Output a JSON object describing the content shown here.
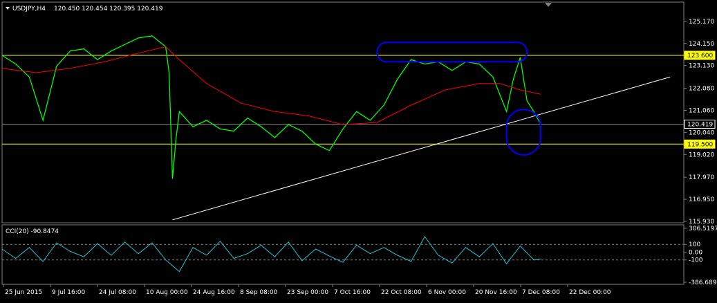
{
  "header": {
    "symbol": "USDJPY,H4",
    "ohlc": "120.450 120.454 120.395 120.419"
  },
  "colors": {
    "price": "#00ff00",
    "ma": "#ff0000",
    "cci": "#1fc6d8",
    "level": "#ffff00",
    "annotation": "#0000ff",
    "trendline": "#ffffff",
    "grid": "#808080"
  },
  "chart_data": [
    {
      "type": "line",
      "title": "USDJPY,H4",
      "ylim": [
        115.93,
        125.9
      ],
      "ytick_labels": [
        "125.170",
        "124.150",
        "123.130",
        "122.080",
        "121.060",
        "120.040",
        "119.020",
        "117.970",
        "116.950",
        "115.930"
      ],
      "price_tags": [
        {
          "label": "123.600",
          "value": 123.6,
          "style": "yellow"
        },
        {
          "label": "120.419",
          "value": 120.419,
          "style": "white"
        },
        {
          "label": "119.500",
          "value": 119.5,
          "style": "yellow"
        }
      ],
      "horizontal_levels": [
        123.6,
        119.5
      ],
      "current_price_line": 120.419,
      "series": [
        {
          "role": "price",
          "x": [
            0,
            0.02,
            0.04,
            0.06,
            0.08,
            0.1,
            0.12,
            0.14,
            0.16,
            0.18,
            0.2,
            0.22,
            0.24,
            0.245,
            0.25,
            0.255,
            0.26,
            0.28,
            0.3,
            0.32,
            0.34,
            0.36,
            0.38,
            0.4,
            0.42,
            0.44,
            0.46,
            0.48,
            0.5,
            0.52,
            0.54,
            0.56,
            0.58,
            0.6,
            0.62,
            0.64,
            0.66,
            0.68,
            0.7,
            0.72,
            0.74,
            0.75,
            0.76,
            0.77,
            0.78,
            0.79
          ],
          "values": [
            123.6,
            123.2,
            122.6,
            120.6,
            123.1,
            123.8,
            123.9,
            123.4,
            123.8,
            124.1,
            124.4,
            124.5,
            124.0,
            122.8,
            117.9,
            119.7,
            121.0,
            120.3,
            120.6,
            120.2,
            120.1,
            120.7,
            120.3,
            119.8,
            120.4,
            120.1,
            119.5,
            119.2,
            120.2,
            121.0,
            120.6,
            121.3,
            122.5,
            123.4,
            123.2,
            123.3,
            122.9,
            123.3,
            123.2,
            122.6,
            121.0,
            122.5,
            123.5,
            121.5,
            121.0,
            120.42
          ]
        },
        {
          "role": "moving-average",
          "x": [
            0,
            0.05,
            0.1,
            0.15,
            0.2,
            0.24,
            0.26,
            0.3,
            0.35,
            0.4,
            0.45,
            0.5,
            0.55,
            0.6,
            0.65,
            0.7,
            0.73,
            0.76,
            0.79
          ],
          "values": [
            123.0,
            122.8,
            123.0,
            123.3,
            123.7,
            124.0,
            123.4,
            122.3,
            121.4,
            121.0,
            120.8,
            120.4,
            120.5,
            121.3,
            122.0,
            122.3,
            122.3,
            122.0,
            121.8
          ]
        }
      ],
      "trendline": {
        "x": [
          0.25,
          0.98
        ],
        "values": [
          116.0,
          122.6
        ]
      },
      "annotations": [
        {
          "shape": "rounded-rect",
          "x": [
            0.55,
            0.77
          ],
          "values": [
            123.3,
            124.2
          ]
        },
        {
          "shape": "oval",
          "x": [
            0.74,
            0.79
          ],
          "values": [
            119.0,
            121.1
          ]
        }
      ]
    },
    {
      "type": "line",
      "title": "CCI(20) -90.8474",
      "ylim": [
        -386.6892,
        306.5197
      ],
      "ytick_labels": [
        "306.5197",
        "100",
        "0.00",
        "-100",
        "-386.6892"
      ],
      "dashed_levels": [
        100,
        -100
      ],
      "series": [
        {
          "role": "cci",
          "x": [
            0,
            0.02,
            0.04,
            0.06,
            0.08,
            0.1,
            0.12,
            0.14,
            0.16,
            0.18,
            0.2,
            0.22,
            0.24,
            0.26,
            0.28,
            0.3,
            0.32,
            0.34,
            0.36,
            0.38,
            0.4,
            0.42,
            0.44,
            0.46,
            0.48,
            0.5,
            0.52,
            0.54,
            0.56,
            0.58,
            0.6,
            0.62,
            0.64,
            0.66,
            0.68,
            0.7,
            0.72,
            0.74,
            0.76,
            0.78,
            0.79
          ],
          "values": [
            40,
            -80,
            60,
            -120,
            120,
            10,
            -60,
            110,
            -40,
            130,
            -20,
            120,
            -100,
            -250,
            60,
            -40,
            140,
            -80,
            -20,
            90,
            -60,
            130,
            -110,
            40,
            -50,
            -130,
            90,
            -20,
            60,
            -40,
            -120,
            200,
            -40,
            -140,
            60,
            -60,
            110,
            -150,
            80,
            -100,
            -91
          ]
        }
      ]
    }
  ],
  "x_axis_labels": [
    "25 Jun 2015",
    "9 Jul 16:00",
    "24 Jul 08:00",
    "10 Aug 00:00",
    "24 Aug 16:00",
    "8 Sep 08:00",
    "23 Sep 00:00",
    "7 Oct 16:00",
    "22 Oct 08:00",
    "6 Nov 00:00",
    "20 Nov 16:00",
    "7 Dec 08:00",
    "22 Dec 00:00"
  ]
}
